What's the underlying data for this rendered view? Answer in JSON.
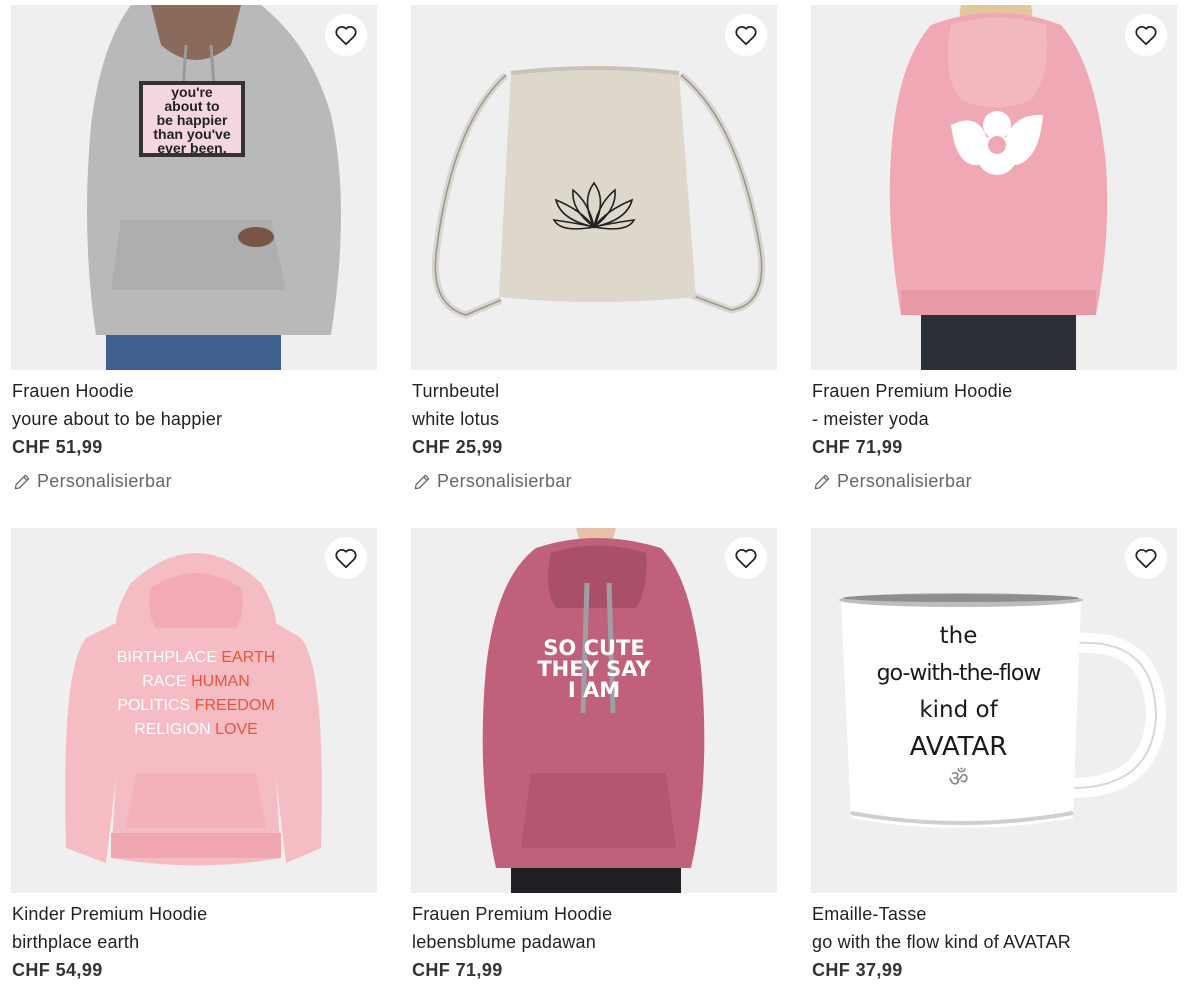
{
  "products": [
    {
      "type": "Frauen Hoodie",
      "name": "youre about to be happier",
      "price": "CHF 51,99",
      "personalizable": "Personalisierbar",
      "image_icon": "grey-hoodie-image",
      "print_text": [
        "you're",
        "about to",
        "be happier",
        "than you've",
        "ever been."
      ]
    },
    {
      "type": "Turnbeutel",
      "name": "white lotus",
      "price": "CHF 25,99",
      "personalizable": "Personalisierbar",
      "image_icon": "drawstring-bag-lotus-image"
    },
    {
      "type": "Frauen Premium Hoodie",
      "name": "- meister yoda",
      "price": "CHF 71,99",
      "personalizable": "Personalisierbar",
      "image_icon": "pink-hoodie-back-image"
    },
    {
      "type": "Kinder Premium Hoodie",
      "name": "birthplace earth",
      "price": "CHF 54,99",
      "image_icon": "kids-pink-hoodie-image",
      "print_lines": [
        {
          "label": "BIRTHPLACE",
          "value": "EARTH"
        },
        {
          "label": "RACE",
          "value": "HUMAN"
        },
        {
          "label": "POLITICS",
          "value": "FREEDOM"
        },
        {
          "label": "RELIGION",
          "value": "LOVE"
        }
      ]
    },
    {
      "type": "Frauen Premium Hoodie",
      "name": "lebensblume padawan",
      "price": "CHF 71,99",
      "image_icon": "rose-hoodie-image",
      "print_text": [
        "SO CUTE",
        "THEY SAY",
        "I AM"
      ]
    },
    {
      "type": "Emaille-Tasse",
      "name": "go with the flow kind of AVATAR",
      "price": "CHF 37,99",
      "image_icon": "enamel-mug-image",
      "print_text": [
        "the",
        "go-with-the-flow",
        "kind of",
        "AVATAR",
        "ॐ"
      ]
    }
  ],
  "colors": {
    "image_bg": "#efefef",
    "text": "#222222",
    "muted": "#666666"
  },
  "icons": {
    "wishlist": "heart-outline-icon",
    "personalize": "pencil-icon"
  }
}
